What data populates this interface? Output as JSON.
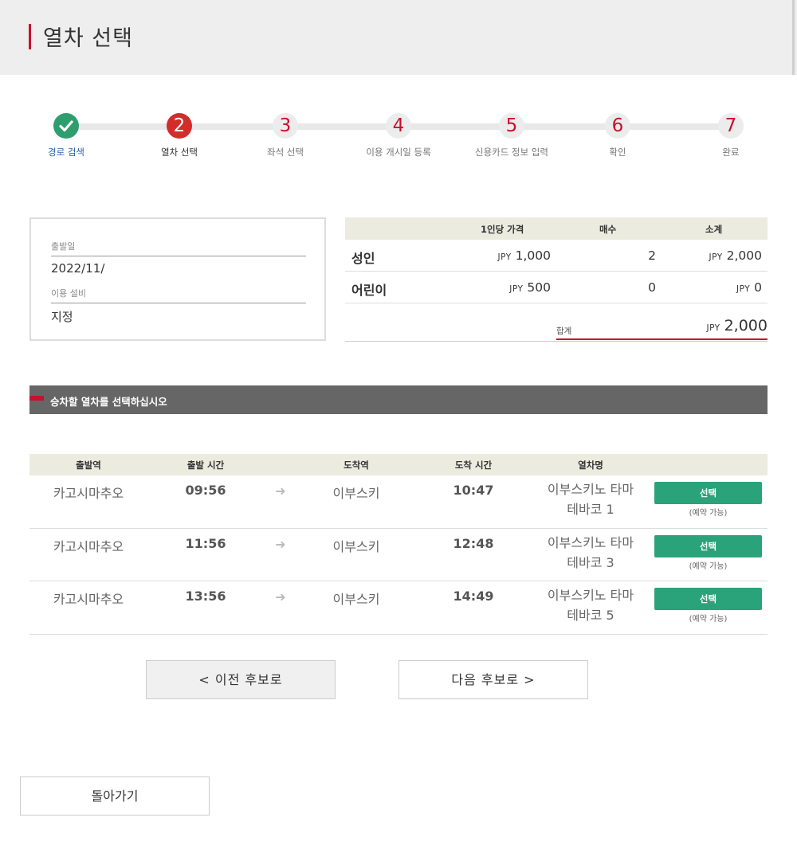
{
  "header": {
    "title": "열차 선택"
  },
  "stepper": {
    "steps": [
      {
        "number": "✓",
        "label": "경로 검색"
      },
      {
        "number": "2",
        "label": "열차 선택"
      },
      {
        "number": "3",
        "label": "좌석 선택"
      },
      {
        "number": "4",
        "label": "이용 개시일 등록"
      },
      {
        "number": "5",
        "label": "신용카드 정보 입력"
      },
      {
        "number": "6",
        "label": "확인"
      },
      {
        "number": "7",
        "label": "완료"
      }
    ]
  },
  "info": {
    "departure_date_label": "출발일",
    "departure_date_value": "2022/11/",
    "facility_label": "이용 설비",
    "facility_value": "지정"
  },
  "price_table": {
    "headers": {
      "unit_price": "1인당 가격",
      "qty": "매수",
      "subtotal": "소계"
    },
    "currency": "JPY",
    "rows": [
      {
        "type": "성인",
        "unit_price": "1,000",
        "qty": "2",
        "subtotal": "2,000"
      },
      {
        "type": "어린이",
        "unit_price": "500",
        "qty": "0",
        "subtotal": "0"
      }
    ],
    "total_label": "합계",
    "total_value": "2,000"
  },
  "section": {
    "title": "승차할 열차를 선택하십시오"
  },
  "trains": {
    "headers": {
      "departure_station": "출발역",
      "departure_time": "출발 시간",
      "arrival_station": "도착역",
      "arrival_time": "도착 시간",
      "train_name": "열차명"
    },
    "rows": [
      {
        "from": "카고시마추오",
        "dep": "09:56",
        "to": "이부스키",
        "arr": "10:47",
        "name1": "이부스키노 타마",
        "name2": "테바코 1",
        "button": "선택",
        "status": "(예약 가능)"
      },
      {
        "from": "카고시마추오",
        "dep": "11:56",
        "to": "이부스키",
        "arr": "12:48",
        "name1": "이부스키노 타마",
        "name2": "테바코 3",
        "button": "선택",
        "status": "(예약 가능)"
      },
      {
        "from": "카고시마추오",
        "dep": "13:56",
        "to": "이부스키",
        "arr": "14:49",
        "name1": "이부스키노 타마",
        "name2": "테바코 5",
        "button": "선택",
        "status": "(예약 가능)"
      }
    ]
  },
  "nav": {
    "prev_label": "< 이전 후보로",
    "next_label": "다음 후보로 >",
    "back_label": "돌아가기"
  },
  "colors": {
    "accent": "#c8102e",
    "success": "#2aa37a",
    "step_done": "#2e9e6f"
  },
  "icons": {
    "step_done": "check-icon",
    "row_arrow": "arrow-right-icon"
  }
}
